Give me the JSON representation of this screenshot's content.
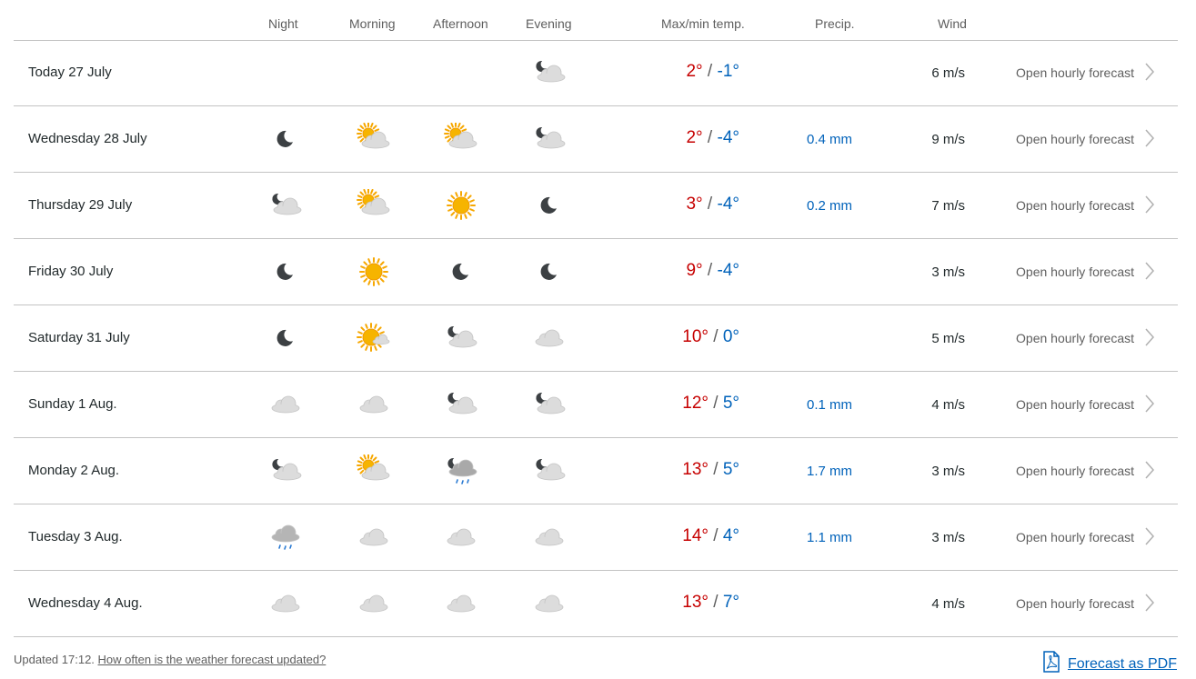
{
  "header": {
    "night": "Night",
    "morning": "Morning",
    "afternoon": "Afternoon",
    "evening": "Evening",
    "temp": "Max/min temp.",
    "precip": "Precip.",
    "wind": "Wind"
  },
  "rows": [
    {
      "day": "Today 27 July",
      "icons": [
        "",
        "",
        "",
        "moon-cloud"
      ],
      "max": "2°",
      "min": "-1°",
      "precip": "",
      "wind": "6 m/s",
      "link": "Open hourly forecast"
    },
    {
      "day": "Wednesday 28 July",
      "icons": [
        "moon",
        "sun-cloud",
        "sun-cloud",
        "moon-cloud"
      ],
      "max": "2°",
      "min": "-4°",
      "precip": "0.4 mm",
      "wind": "9 m/s",
      "link": "Open hourly forecast"
    },
    {
      "day": "Thursday 29 July",
      "icons": [
        "moon-cloud",
        "sun-cloud",
        "sun",
        "moon"
      ],
      "max": "3°",
      "min": "-4°",
      "precip": "0.2 mm",
      "wind": "7 m/s",
      "link": "Open hourly forecast"
    },
    {
      "day": "Friday 30 July",
      "icons": [
        "moon",
        "sun",
        "moon",
        "moon"
      ],
      "max": "9°",
      "min": "-4°",
      "precip": "",
      "wind": "3 m/s",
      "link": "Open hourly forecast"
    },
    {
      "day": "Saturday 31 July",
      "icons": [
        "moon",
        "sun-small-cloud",
        "moon-cloud",
        "cloud"
      ],
      "max": "10°",
      "min": "0°",
      "precip": "",
      "wind": "5 m/s",
      "link": "Open hourly forecast"
    },
    {
      "day": "Sunday 1 Aug.",
      "icons": [
        "cloud",
        "cloud",
        "moon-cloud",
        "moon-cloud"
      ],
      "max": "12°",
      "min": "5°",
      "precip": "0.1 mm",
      "wind": "4 m/s",
      "link": "Open hourly forecast"
    },
    {
      "day": "Monday 2 Aug.",
      "icons": [
        "moon-cloud",
        "sun-cloud",
        "moon-rain-cloud",
        "moon-cloud"
      ],
      "max": "13°",
      "min": "5°",
      "precip": "1.7 mm",
      "wind": "3 m/s",
      "link": "Open hourly forecast"
    },
    {
      "day": "Tuesday 3 Aug.",
      "icons": [
        "rain-cloud",
        "cloud",
        "cloud",
        "cloud"
      ],
      "max": "14°",
      "min": "4°",
      "precip": "1.1 mm",
      "wind": "3 m/s",
      "link": "Open hourly forecast"
    },
    {
      "day": "Wednesday 4 Aug.",
      "icons": [
        "cloud",
        "cloud",
        "cloud",
        "cloud"
      ],
      "max": "13°",
      "min": "7°",
      "precip": "",
      "wind": "4 m/s",
      "link": "Open hourly forecast"
    }
  ],
  "footer": {
    "updated": "Updated 17:12.",
    "faq_link": "How often is the weather forecast updated?",
    "pdf_link": "Forecast as PDF"
  },
  "colors": {
    "max_temp": "#c60000",
    "min_temp": "#0062ba",
    "precip": "#0062ba",
    "divider": "#c3c3c3"
  }
}
